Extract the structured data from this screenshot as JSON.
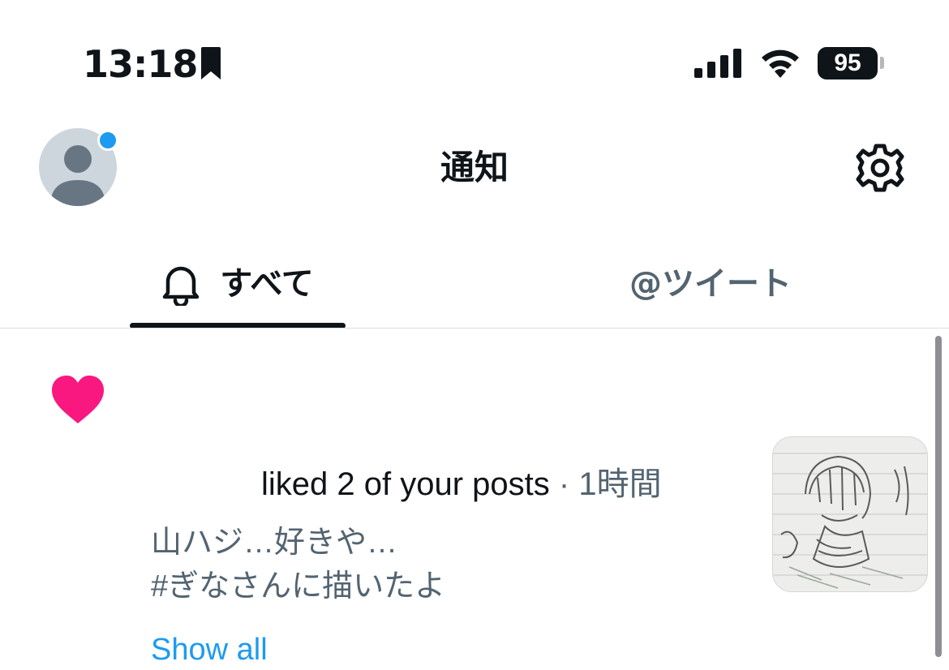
{
  "status_bar": {
    "time": "13:18",
    "battery": "95",
    "icons": [
      "bookmark-icon",
      "signal-icon",
      "wifi-icon",
      "battery-icon"
    ]
  },
  "header": {
    "title": "通知",
    "icons": [
      "avatar",
      "gear-icon"
    ]
  },
  "tabs": [
    {
      "label": "すべて",
      "icon": "bell-icon",
      "selected": true
    },
    {
      "label": "@ツイート",
      "selected": false
    }
  ],
  "notification": {
    "icon": "heart-icon",
    "action": "liked 2 of your posts",
    "separator": "·",
    "time": "1時間",
    "post_lines": [
      "山ハジ…好きや…",
      "#ぎなさんに描いたよ"
    ],
    "show_all": "Show all"
  },
  "colors": {
    "accent": "#1d9bf0",
    "like": "#f91880",
    "text_primary": "#0f1419",
    "text_secondary": "#536471"
  }
}
